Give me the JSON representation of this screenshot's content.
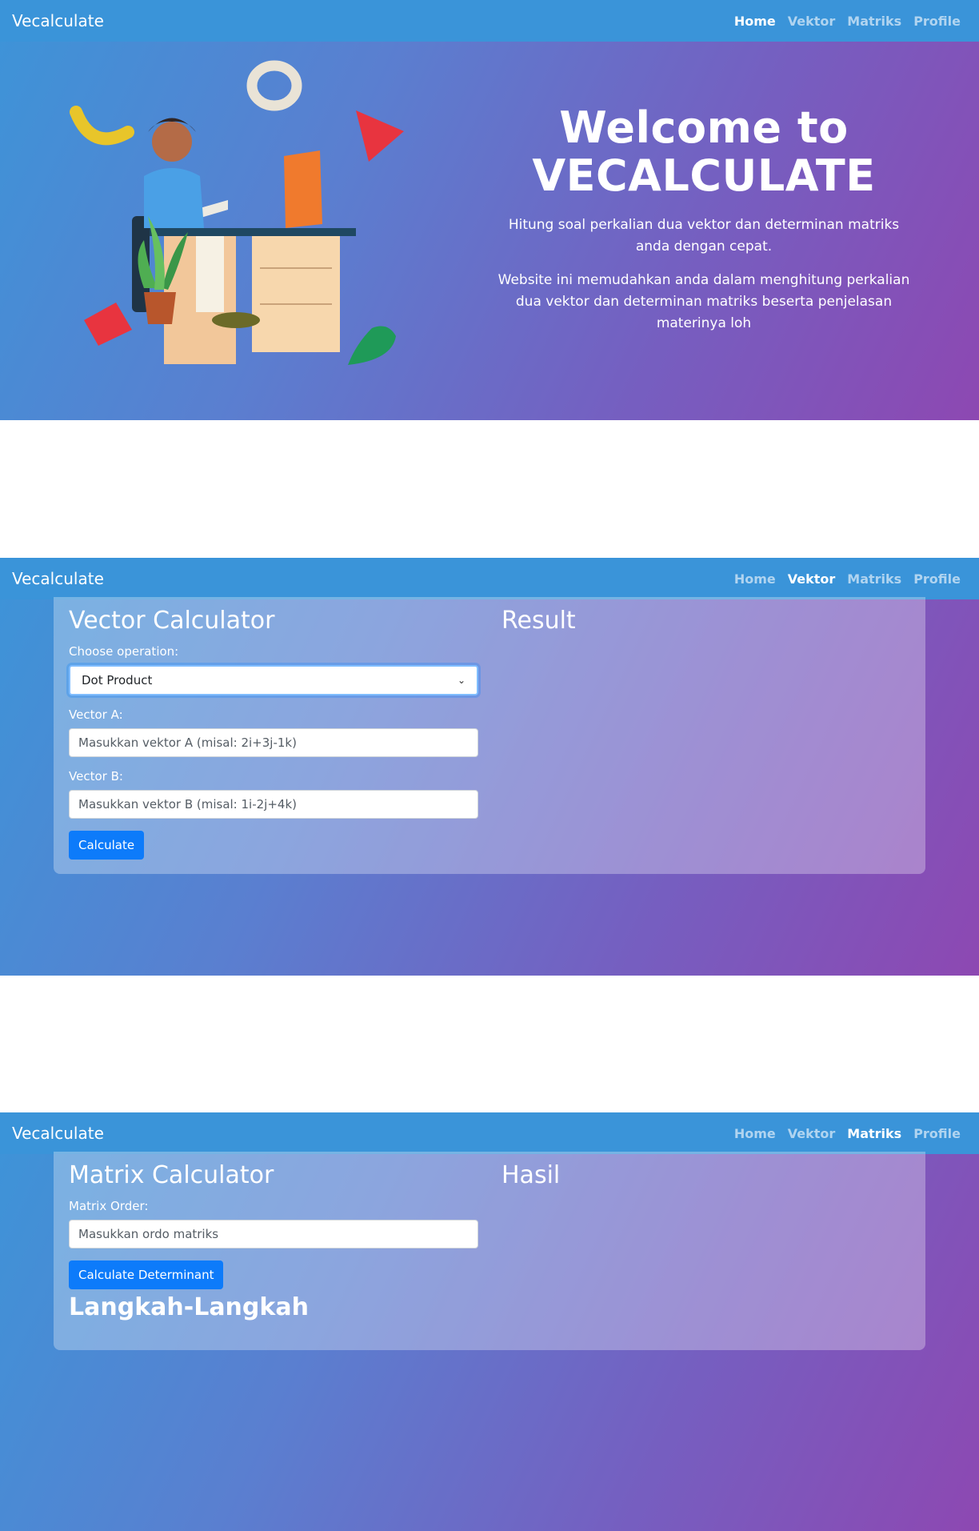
{
  "brand": "Vecalculate",
  "nav": {
    "home": "Home",
    "vektor": "Vektor",
    "matriks": "Matriks",
    "profile": "Profile"
  },
  "hero": {
    "title_line1": "Welcome to",
    "title_line2": "VECALCULATE",
    "p1": "Hitung soal perkalian dua vektor dan determinan matriks anda dengan cepat.",
    "p2": "Website ini memudahkan anda dalam menghitung perkalian dua vektor dan determinan matriks beserta penjelasan materinya loh"
  },
  "vector": {
    "title": "Vector Calculator",
    "operation_label": "Choose operation:",
    "operation_value": "Dot Product",
    "a_label": "Vector A:",
    "a_placeholder": "Masukkan vektor A (misal: 2i+3j-1k)",
    "b_label": "Vector B:",
    "b_placeholder": "Masukkan vektor B (misal: 1i-2j+4k)",
    "button": "Calculate",
    "result_title": "Result"
  },
  "matrix": {
    "title": "Matrix Calculator",
    "order_label": "Matrix Order:",
    "order_placeholder": "Masukkan ordo matriks",
    "button": "Calculate Determinant",
    "steps_title": "Langkah-Langkah",
    "result_title": "Hasil"
  },
  "colors": {
    "navbar": "#3a94d9",
    "gradient_start": "#3d94d8",
    "gradient_end": "#8d48b2",
    "button": "#0d7bfa"
  }
}
